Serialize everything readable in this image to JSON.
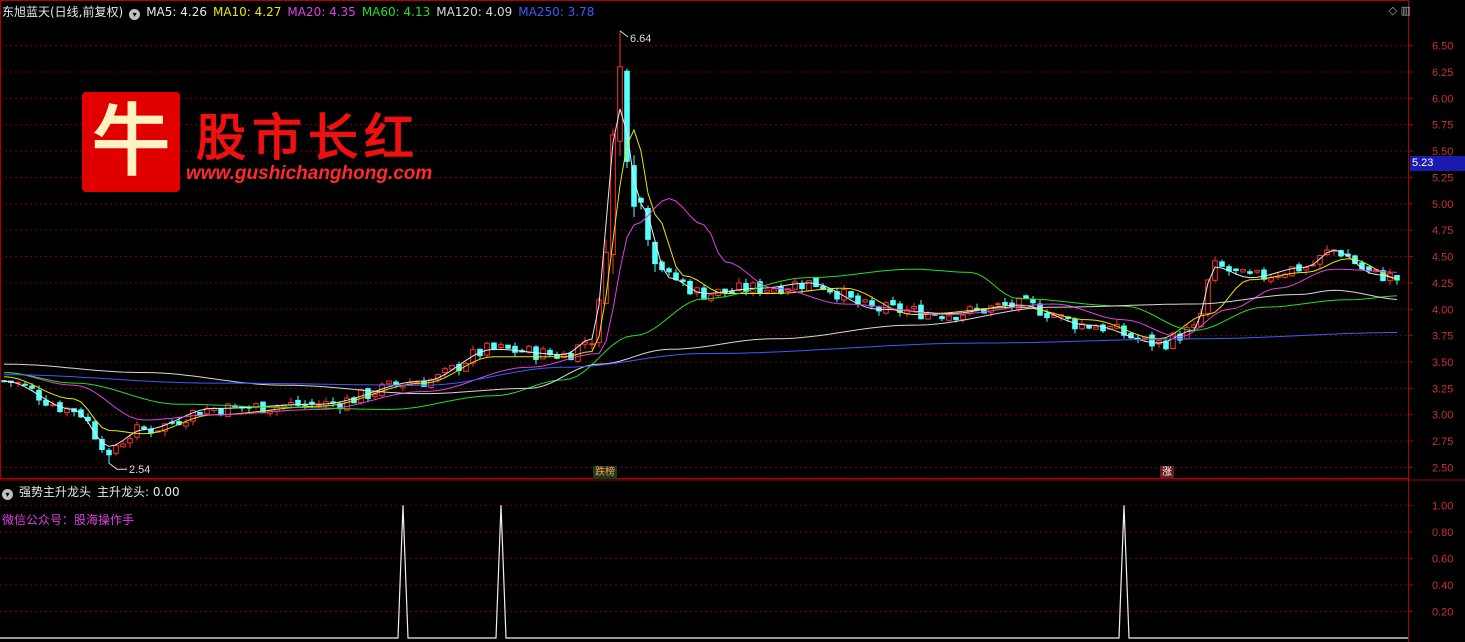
{
  "header": {
    "stock": "东旭蓝天(日线,前复权)",
    "ma": [
      {
        "label": "MA5: 4.26",
        "color": "#e8e8e8"
      },
      {
        "label": "MA10: 4.27",
        "color": "#e8e800"
      },
      {
        "label": "MA20: 4.35",
        "color": "#e040e0"
      },
      {
        "label": "MA60: 4.13",
        "color": "#20e020"
      },
      {
        "label": "MA120: 4.09",
        "color": "#d8d8d8"
      },
      {
        "label": "MA250: 3.78",
        "color": "#3a5cff"
      }
    ]
  },
  "logo": {
    "glyph": "牛",
    "title": "股市长红",
    "url": "www.gushichanghong.com"
  },
  "price_tag": "5.23",
  "signals": [
    {
      "label": "跌榜",
      "color": "#ff8844",
      "bg": "#1a3a1a"
    },
    {
      "label": "涨",
      "color": "#ffffff",
      "bg": "#6a1a1a"
    }
  ],
  "indicator": {
    "title": "强势主升龙头",
    "value_label": "主升龙头: 0.00",
    "note": "微信公众号：股海操作手"
  },
  "colors": {
    "up": "#ff3030",
    "down": "#54ffff",
    "grid": "#7a0000",
    "axis": "#b00000",
    "axis_text": "#c83232"
  },
  "chart_data": [
    {
      "type": "candlestick",
      "ylim": [
        2.4,
        6.8
      ],
      "y_ticks": [
        "2.50",
        "2.75",
        "3.00",
        "3.25",
        "3.50",
        "3.75",
        "4.00",
        "4.25",
        "4.50",
        "4.75",
        "5.00",
        "5.25",
        "5.50",
        "5.75",
        "6.00",
        "6.25",
        "6.50"
      ],
      "annotations": [
        {
          "label": "6.64",
          "price": 6.64
        },
        {
          "label": "2.54",
          "price": 2.54
        }
      ],
      "series": [
        {
          "name": "MA5",
          "anchors": [
            [
              0,
              3.32
            ],
            [
              10,
              3.05
            ],
            [
              15,
              2.7
            ],
            [
              20,
              2.86
            ],
            [
              30,
              3.06
            ],
            [
              45,
              3.1
            ],
            [
              60,
              3.32
            ],
            [
              70,
              3.62
            ],
            [
              80,
              3.57
            ],
            [
              84,
              3.72
            ],
            [
              88,
              5.9
            ],
            [
              91,
              5.0
            ],
            [
              95,
              4.3
            ],
            [
              100,
              4.15
            ],
            [
              108,
              4.2
            ],
            [
              115,
              4.25
            ],
            [
              125,
              4.0
            ],
            [
              135,
              3.96
            ],
            [
              145,
              4.04
            ],
            [
              155,
              3.85
            ],
            [
              165,
              3.68
            ],
            [
              170,
              3.8
            ],
            [
              173,
              4.4
            ],
            [
              178,
              4.3
            ],
            [
              186,
              4.4
            ],
            [
              190,
              4.56
            ],
            [
              196,
              4.33
            ],
            [
              200,
              4.28
            ]
          ]
        },
        {
          "name": "MA10",
          "anchors": [
            [
              0,
              3.36
            ],
            [
              10,
              3.15
            ],
            [
              15,
              2.85
            ],
            [
              20,
              2.82
            ],
            [
              30,
              3.0
            ],
            [
              45,
              3.08
            ],
            [
              60,
              3.3
            ],
            [
              70,
              3.55
            ],
            [
              80,
              3.55
            ],
            [
              84,
              3.6
            ],
            [
              90,
              5.7
            ],
            [
              93,
              4.9
            ],
            [
              97,
              4.32
            ],
            [
              103,
              4.15
            ],
            [
              110,
              4.15
            ],
            [
              120,
              4.2
            ],
            [
              130,
              3.95
            ],
            [
              145,
              4.02
            ],
            [
              155,
              3.9
            ],
            [
              165,
              3.72
            ],
            [
              172,
              3.95
            ],
            [
              178,
              4.28
            ],
            [
              186,
              4.35
            ],
            [
              192,
              4.48
            ],
            [
              200,
              4.28
            ]
          ]
        },
        {
          "name": "MA20",
          "anchors": [
            [
              0,
              3.4
            ],
            [
              10,
              3.28
            ],
            [
              20,
              2.95
            ],
            [
              30,
              3.0
            ],
            [
              45,
              3.05
            ],
            [
              60,
              3.22
            ],
            [
              75,
              3.45
            ],
            [
              85,
              3.58
            ],
            [
              90,
              4.8
            ],
            [
              95,
              5.05
            ],
            [
              100,
              4.8
            ],
            [
              103,
              4.45
            ],
            [
              110,
              4.2
            ],
            [
              120,
              4.05
            ],
            [
              135,
              3.95
            ],
            [
              150,
              4.05
            ],
            [
              160,
              3.9
            ],
            [
              168,
              3.74
            ],
            [
              175,
              4.0
            ],
            [
              182,
              4.2
            ],
            [
              190,
              4.38
            ],
            [
              200,
              4.35
            ]
          ]
        },
        {
          "name": "MA60",
          "anchors": [
            [
              0,
              3.4
            ],
            [
              10,
              3.3
            ],
            [
              25,
              3.1
            ],
            [
              40,
              3.07
            ],
            [
              55,
              3.05
            ],
            [
              70,
              3.18
            ],
            [
              80,
              3.33
            ],
            [
              90,
              3.75
            ],
            [
              100,
              4.1
            ],
            [
              115,
              4.3
            ],
            [
              130,
              4.38
            ],
            [
              138,
              4.35
            ],
            [
              145,
              4.1
            ],
            [
              160,
              4.03
            ],
            [
              170,
              3.8
            ],
            [
              180,
              4.02
            ],
            [
              192,
              4.09
            ],
            [
              200,
              4.13
            ]
          ]
        },
        {
          "name": "MA120",
          "anchors": [
            [
              0,
              3.48
            ],
            [
              20,
              3.4
            ],
            [
              40,
              3.28
            ],
            [
              60,
              3.2
            ],
            [
              75,
              3.25
            ],
            [
              85,
              3.48
            ],
            [
              95,
              3.62
            ],
            [
              110,
              3.72
            ],
            [
              130,
              3.85
            ],
            [
              150,
              4.02
            ],
            [
              170,
              4.05
            ],
            [
              185,
              4.14
            ],
            [
              190,
              4.18
            ],
            [
              200,
              4.09
            ]
          ]
        },
        {
          "name": "MA250",
          "anchors": [
            [
              0,
              3.38
            ],
            [
              30,
              3.3
            ],
            [
              60,
              3.28
            ],
            [
              80,
              3.45
            ],
            [
              100,
              3.58
            ],
            [
              140,
              3.68
            ],
            [
              170,
              3.72
            ],
            [
              200,
              3.78
            ]
          ]
        }
      ]
    },
    {
      "type": "line",
      "ylim": [
        0,
        1.1
      ],
      "y_ticks": [
        "0.20",
        "0.40",
        "0.60",
        "0.80",
        "1.00"
      ],
      "peaks": [
        57,
        71,
        160
      ],
      "values_nonzero": 1.0
    }
  ]
}
